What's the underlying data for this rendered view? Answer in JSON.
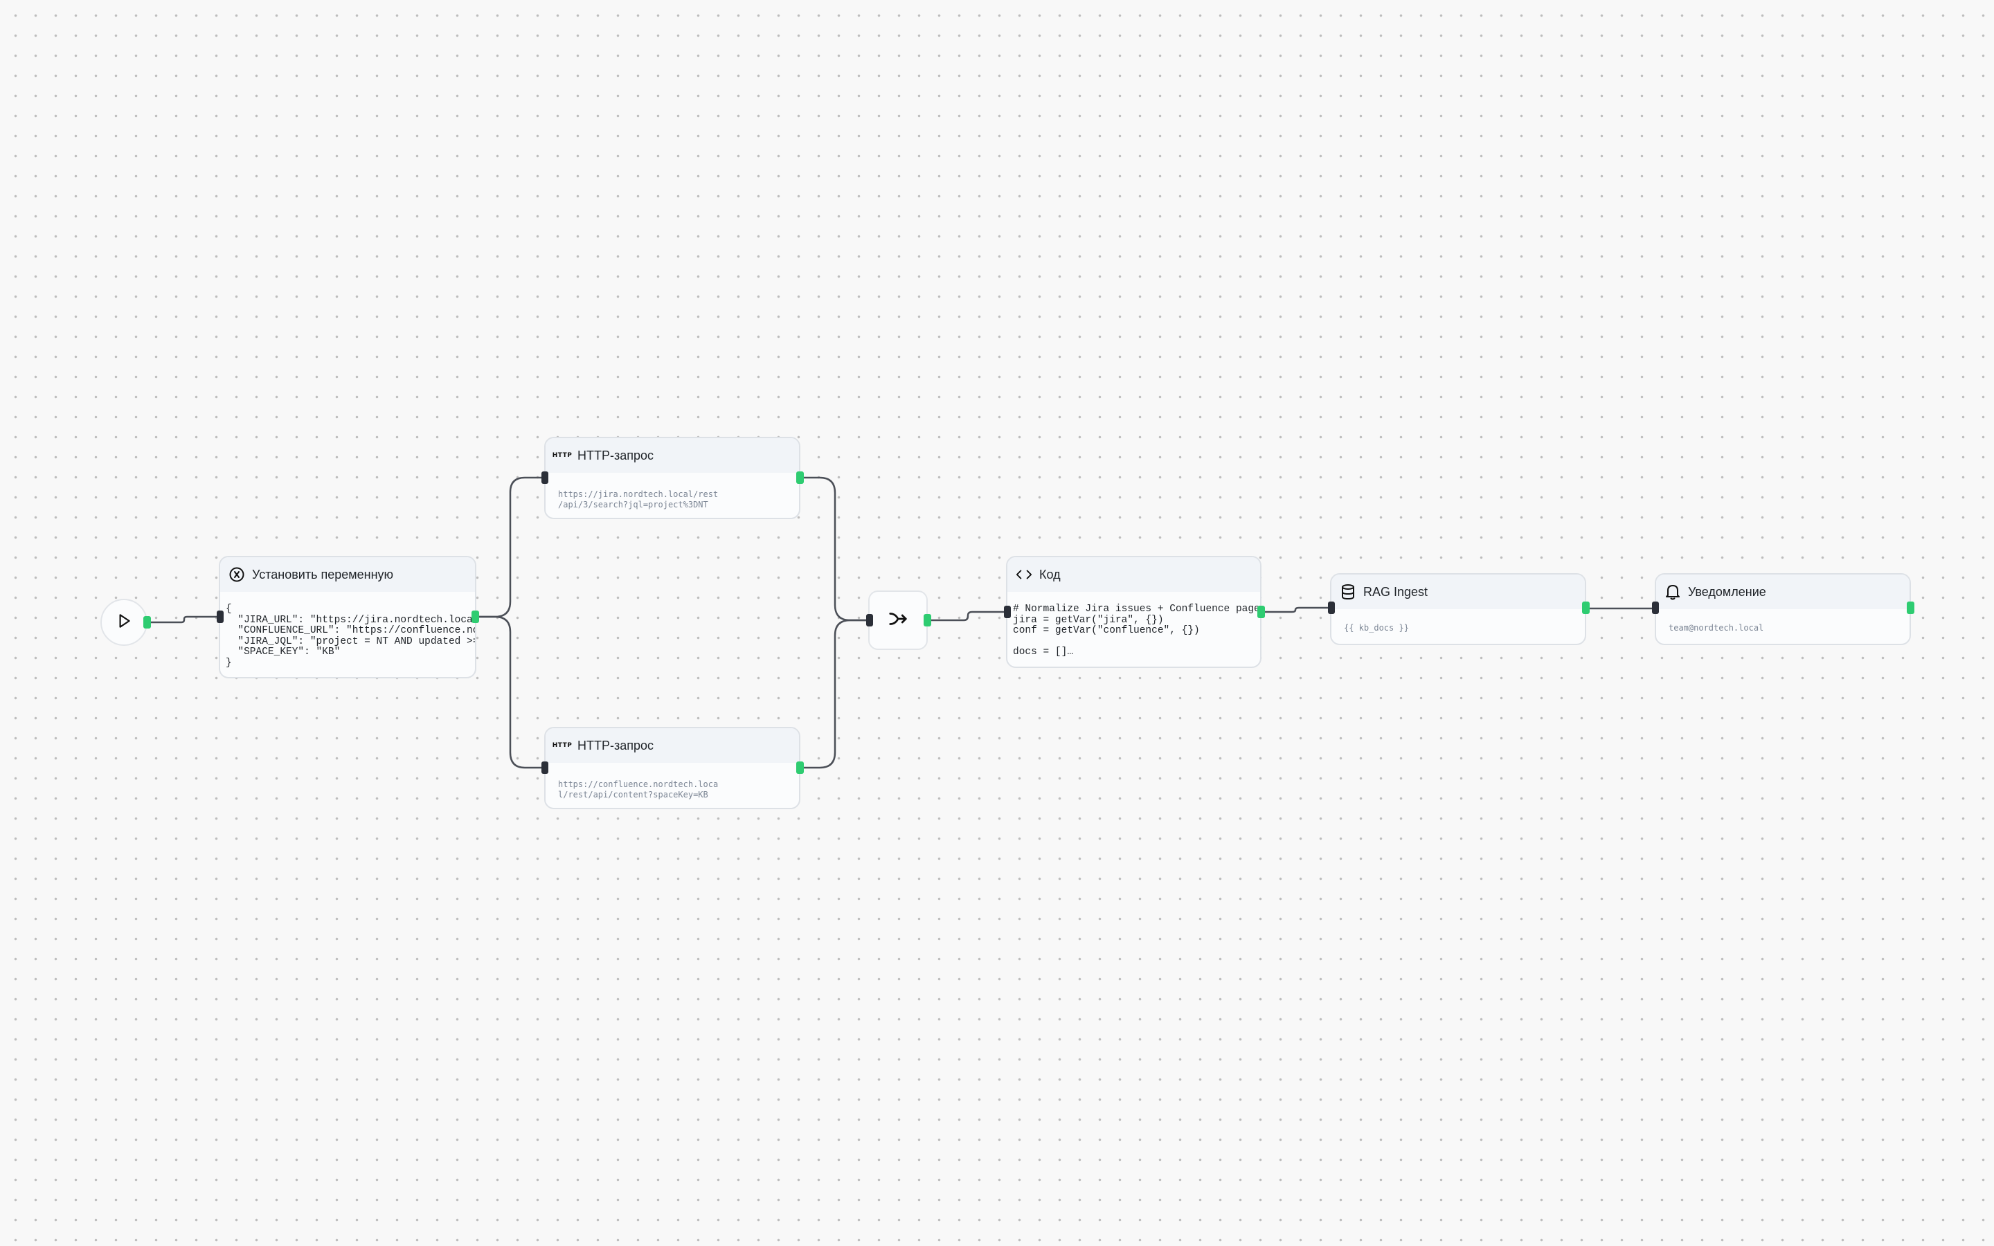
{
  "canvas": {
    "nodes": {
      "start": {
        "icon": "play-icon"
      },
      "set_variable": {
        "title": "Установить переменную",
        "icon": "variable-icon",
        "code": "{\n  \"JIRA_URL\": \"https://jira.nordtech.local\",\n  \"CONFLUENCE_URL\": \"https://confluence.nordtech.local\",\n  \"JIRA_JQL\": \"project = NT AND updated >=\n  \"SPACE_KEY\": \"KB\"\n}"
      },
      "http_jira": {
        "title": "HTTP-запрос",
        "badge": "HTTP",
        "url": "https://jira.nordtech.local/rest\n/api/3/search?jql=project%3DNT"
      },
      "http_confluence": {
        "title": "HTTP-запрос",
        "badge": "HTTP",
        "url": "https://confluence.nordtech.loca\nl/rest/api/content?spaceKey=KB"
      },
      "merge": {
        "icon": "merge-icon"
      },
      "code": {
        "title": "Код",
        "icon": "code-icon",
        "code": "# Normalize Jira issues + Confluence page…\njira = getVar(\"jira\", {})\nconf = getVar(\"confluence\", {})\n\ndocs = []…"
      },
      "rag_ingest": {
        "title": "RAG Ingest",
        "icon": "database-icon",
        "subtitle": "{{ kb_docs }}"
      },
      "notification": {
        "title": "Уведомление",
        "icon": "bell-icon",
        "subtitle": "team@nordtech.local"
      }
    },
    "colors": {
      "canvas_bg": "#f8f8f8",
      "grid_dot": "#bdbdbd",
      "node_bg": "#fbfcfd",
      "node_header_bg": "#f1f4f8",
      "node_border": "#dde1e6",
      "edge": "#4b4f57",
      "output_handle": "#2ecc71",
      "input_handle": "#2b2f38"
    }
  }
}
